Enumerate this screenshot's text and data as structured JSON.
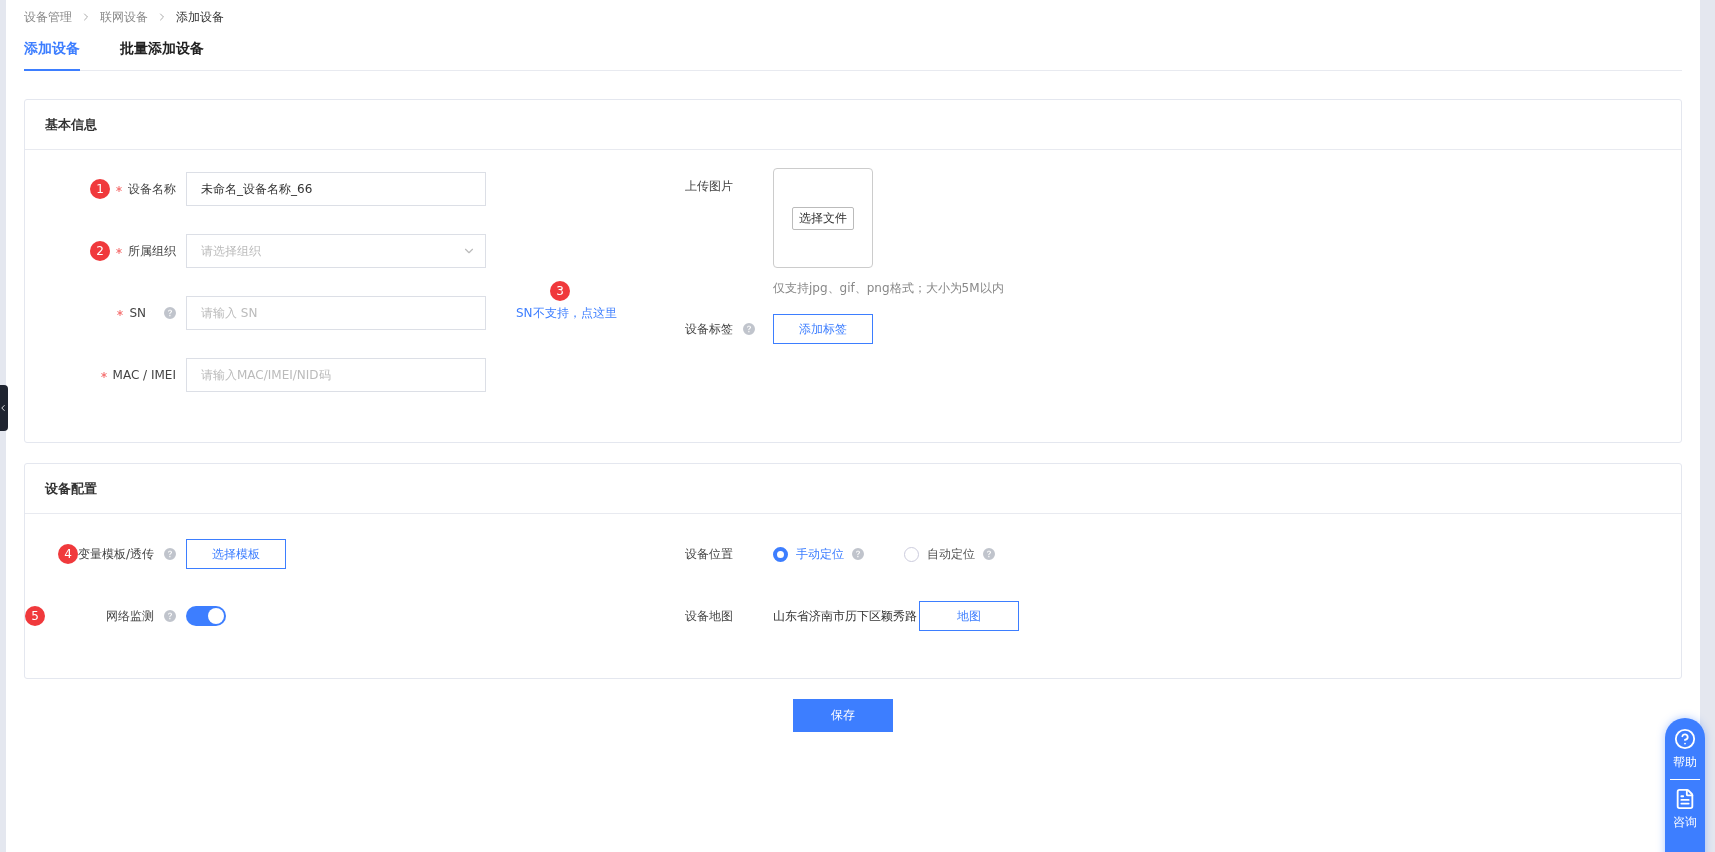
{
  "breadcrumb": [
    "设备管理",
    "联网设备",
    "添加设备"
  ],
  "tabs": [
    {
      "label": "添加设备",
      "selected": true
    },
    {
      "label": "批量添加设备",
      "selected": false
    }
  ],
  "basic_info": {
    "title": "基本信息",
    "fields": [
      {
        "kind": "input",
        "badge": "1",
        "required": true,
        "help": false,
        "label": "设备名称",
        "value": "未命名_设备名称_66"
      },
      {
        "kind": "select",
        "badge": "2",
        "required": true,
        "help": false,
        "label": "所属组织",
        "placeholder": "请选择组织"
      },
      {
        "kind": "input",
        "required": true,
        "help": true,
        "label": "SN",
        "placeholder": "请输入 SN",
        "link": {
          "text": "SN不支持，点这里",
          "badge": "3"
        }
      },
      {
        "kind": "input",
        "required": true,
        "help": false,
        "label": "MAC / IMEI",
        "placeholder": "请输入MAC/IMEI/NID码"
      }
    ],
    "upload": {
      "label": "上传图片",
      "button": "选择文件",
      "hint": "仅支持jpg、gif、png格式；大小为5M以内"
    },
    "tags": {
      "label": "设备标签",
      "help": true,
      "button": "添加标签"
    }
  },
  "device_config": {
    "title": "设备配置",
    "template": {
      "badge": "4",
      "label": "变量模板/透传",
      "help": true,
      "button": "选择模板"
    },
    "network": {
      "badge": "5",
      "label": "网络监测",
      "help": true,
      "on": true
    },
    "location": {
      "label": "设备位置",
      "options": [
        {
          "label": "手动定位",
          "selected": true,
          "help": true
        },
        {
          "label": "自动定位",
          "selected": false,
          "help": true
        }
      ]
    },
    "map": {
      "label": "设备地图",
      "address": "山东省济南市历下区颖秀路",
      "button": "地图"
    }
  },
  "save_button": "保存",
  "help_widget": [
    {
      "kind": "help",
      "label": "帮助"
    },
    {
      "kind": "consult",
      "label": "咨询"
    }
  ]
}
